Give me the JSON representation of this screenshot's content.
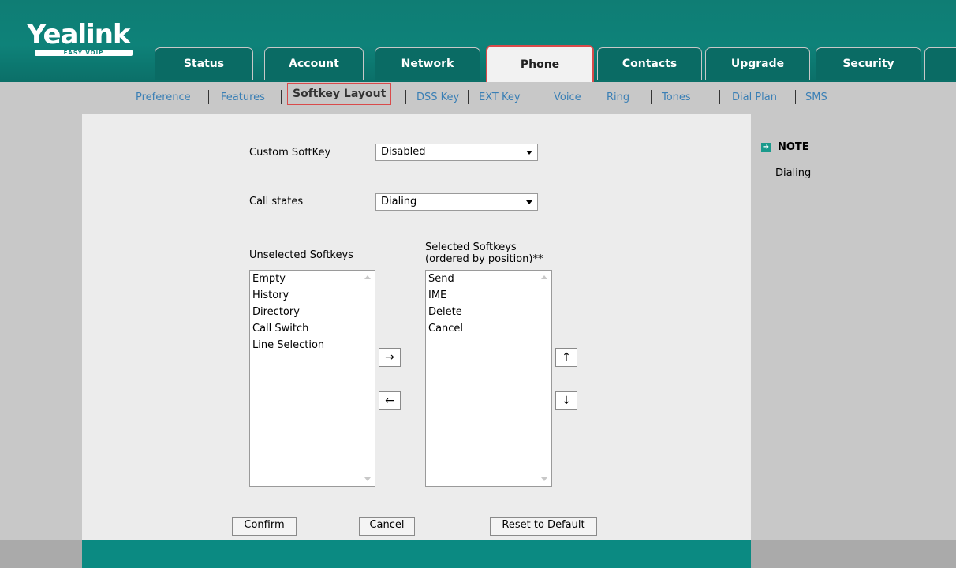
{
  "header": {
    "logo": "Yealink",
    "logo_tagline": "EASY VOIP",
    "tabs": [
      {
        "label": "Status"
      },
      {
        "label": "Account"
      },
      {
        "label": "Network"
      },
      {
        "label": "Phone"
      },
      {
        "label": "Contacts"
      },
      {
        "label": "Upgrade"
      },
      {
        "label": "Security"
      }
    ],
    "active_tab": "Phone"
  },
  "subnav": {
    "items": [
      {
        "label": "Preference"
      },
      {
        "label": "Features"
      },
      {
        "label": "Softkey Layout"
      },
      {
        "label": "DSS Key"
      },
      {
        "label": "EXT Key"
      },
      {
        "label": "Voice"
      },
      {
        "label": "Ring"
      },
      {
        "label": "Tones"
      },
      {
        "label": "Dial Plan"
      },
      {
        "label": "SMS"
      }
    ],
    "active_item": "Softkey Layout"
  },
  "form": {
    "custom_softkey_label": "Custom SoftKey",
    "custom_softkey_value": "Disabled",
    "call_states_label": "Call states",
    "call_states_value": "Dialing",
    "unselected_label": "Unselected Softkeys",
    "selected_label_line1": "Selected Softkeys",
    "selected_label_line2": "(ordered by position)**",
    "unselected_items": [
      "Empty",
      "History",
      "Directory",
      "Call Switch",
      "Line Selection"
    ],
    "selected_items": [
      "Send",
      "IME",
      "Delete",
      "Cancel"
    ],
    "move_right": "→",
    "move_left": "←",
    "move_up": "↑",
    "move_down": "↓",
    "confirm": "Confirm",
    "cancel": "Cancel",
    "reset": "Reset to Default"
  },
  "note": {
    "title": "NOTE",
    "text": "Dialing"
  },
  "colors": {
    "header_teal": "#0e8279",
    "active_tab_border": "#d94a4a",
    "link_blue": "#3a7fb5"
  }
}
